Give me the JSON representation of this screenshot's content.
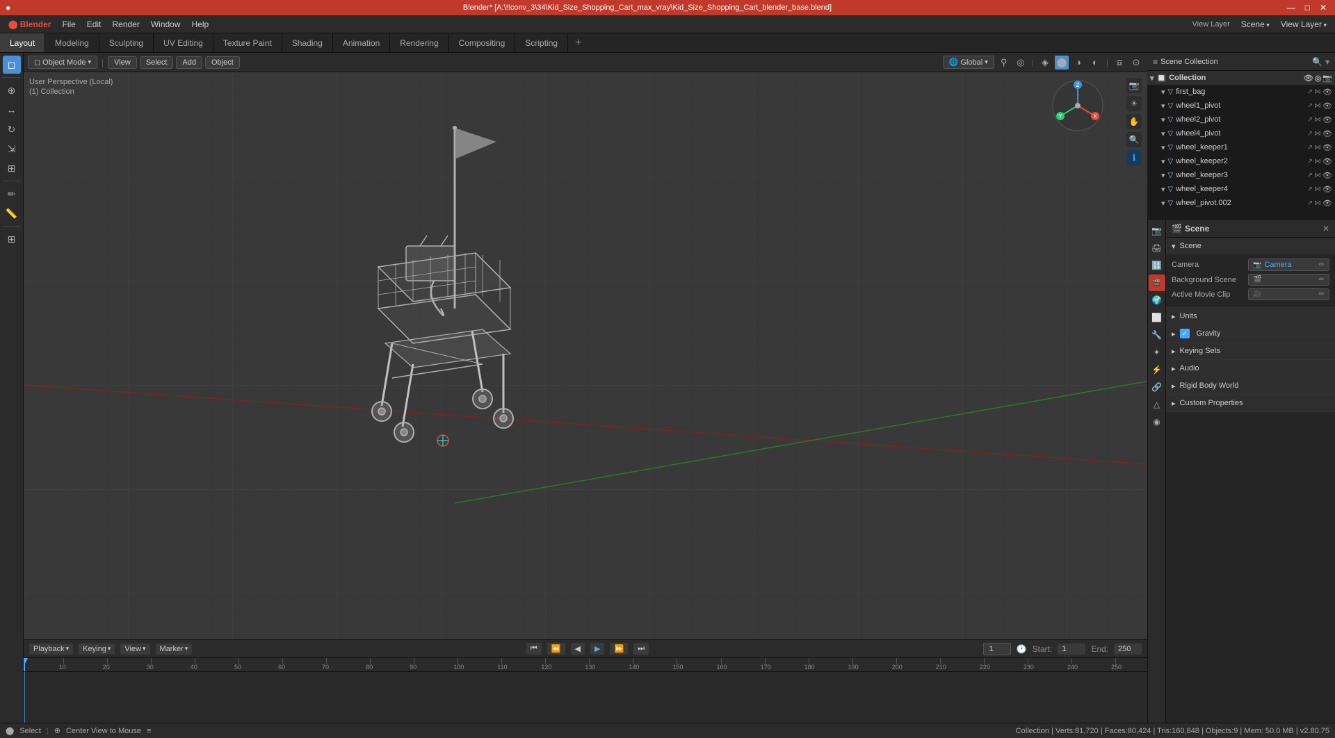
{
  "titlebar": {
    "title": "Blender* [A:\\!!conv_3\\34\\Kid_Size_Shopping_Cart_max_vray\\Kid_Size_Shopping_Cart_blender_base.blend]",
    "controls": [
      "—",
      "□",
      "✕"
    ]
  },
  "menubar": {
    "items": [
      "Blender",
      "File",
      "Edit",
      "Render",
      "Window",
      "Help"
    ]
  },
  "tabs": {
    "items": [
      "Layout",
      "Modeling",
      "Sculpting",
      "UV Editing",
      "Texture Paint",
      "Shading",
      "Animation",
      "Rendering",
      "Compositing",
      "Scripting"
    ],
    "active": "Layout",
    "plus": "+"
  },
  "viewport_header": {
    "mode_dropdown": "Object Mode",
    "global_dropdown": "Global",
    "view_btn": "View",
    "select_btn": "Select",
    "add_btn": "Add",
    "object_btn": "Object"
  },
  "viewport_info": {
    "line1": "User Perspective (Local)",
    "line2": "(1) Collection"
  },
  "outliner": {
    "header_title": "Scene Collection",
    "items": [
      {
        "name": "Collection",
        "depth": 0,
        "type": "collection",
        "expanded": true
      },
      {
        "name": "first_bag",
        "depth": 1,
        "type": "mesh"
      },
      {
        "name": "wheel1_pivot",
        "depth": 1,
        "type": "mesh"
      },
      {
        "name": "wheel2_pivot",
        "depth": 1,
        "type": "mesh"
      },
      {
        "name": "wheel4_pivot",
        "depth": 1,
        "type": "mesh"
      },
      {
        "name": "wheel_keeper1",
        "depth": 1,
        "type": "mesh"
      },
      {
        "name": "wheel_keeper2",
        "depth": 1,
        "type": "mesh"
      },
      {
        "name": "wheel_keeper3",
        "depth": 1,
        "type": "mesh"
      },
      {
        "name": "wheel_keeper4",
        "depth": 1,
        "type": "mesh"
      },
      {
        "name": "wheel_pivot.002",
        "depth": 1,
        "type": "mesh"
      }
    ]
  },
  "properties": {
    "panel_title": "Scene",
    "tabs": [
      "render",
      "output",
      "view_layer",
      "scene",
      "world",
      "object",
      "modifier",
      "particles",
      "physics",
      "constraints",
      "object_data",
      "material",
      "texture"
    ],
    "active_tab": "scene",
    "scene_name": "Scene",
    "sections": [
      {
        "name": "Scene",
        "expanded": true,
        "rows": [
          {
            "label": "Camera",
            "value": ""
          },
          {
            "label": "Background Scene",
            "value": ""
          },
          {
            "label": "Active Movie Clip",
            "value": ""
          }
        ]
      },
      {
        "name": "Units",
        "expanded": false
      },
      {
        "name": "Gravity",
        "expanded": false,
        "checkbox": true
      },
      {
        "name": "Keying Sets",
        "expanded": false
      },
      {
        "name": "Audio",
        "expanded": false
      },
      {
        "name": "Rigid Body World",
        "expanded": false
      },
      {
        "name": "Custom Properties",
        "expanded": false
      }
    ]
  },
  "timeline": {
    "playback_label": "Playback",
    "keying_label": "Keying",
    "view_label": "View",
    "marker_label": "Marker",
    "frame_current": "1",
    "start_label": "Start:",
    "start_value": "1",
    "end_label": "End:",
    "end_value": "250",
    "frame_markers": [
      1,
      10,
      20,
      30,
      40,
      50,
      60,
      70,
      80,
      90,
      100,
      110,
      120,
      130,
      140,
      150,
      160,
      170,
      180,
      190,
      200,
      210,
      220,
      230,
      240,
      250
    ]
  },
  "statusbar": {
    "left": "Select",
    "center": "Center View to Mouse",
    "right": "Collection | Verts:81,720 | Faces:80,424 | Tris:160,848 | Objects:9 | Mem: 50.0 MB | v2.80.75"
  },
  "nav_gizmo": {
    "x_label": "X",
    "y_label": "Y",
    "z_label": "Z"
  }
}
